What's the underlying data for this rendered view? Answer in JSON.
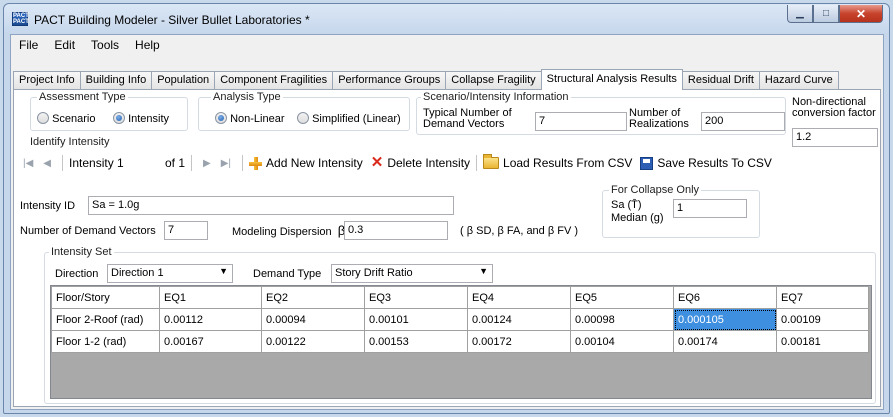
{
  "window": {
    "title": "PACT Building Modeler - Silver Bullet Laboratories *",
    "app_icon_text": [
      "PACT",
      "PACT"
    ]
  },
  "window_controls": {
    "minimize": "▁",
    "maximize": "□",
    "close": "✕"
  },
  "menu": [
    "File",
    "Edit",
    "Tools",
    "Help"
  ],
  "tabs": [
    "Project Info",
    "Building Info",
    "Population",
    "Component Fragilities",
    "Performance Groups",
    "Collapse Fragility",
    "Structural Analysis Results",
    "Residual Drift",
    "Hazard Curve"
  ],
  "active_tab": "Structural Analysis Results",
  "assessment_type": {
    "title": "Assessment Type",
    "options": [
      "Scenario",
      "Intensity"
    ],
    "selected": "Intensity"
  },
  "analysis_type": {
    "title": "Analysis Type",
    "options": [
      "Non-Linear",
      "Simplified (Linear)"
    ],
    "selected": "Non-Linear"
  },
  "scenario_info": {
    "title": "Scenario/Intensity Information",
    "demand_vectors_label": "Typical Number of\nDemand Vectors",
    "demand_vectors_value": "7",
    "realizations_label": "Number of\nRealizations",
    "realizations_value": "200"
  },
  "non_directional": {
    "label": "Non-directional\nconversion factor",
    "value": "1.2"
  },
  "identify_intensity": {
    "title": "Identify Intensity",
    "nav": {
      "first": "|◀",
      "prev": "◀",
      "next": "▶",
      "last": "▶|"
    },
    "current": "Intensity 1",
    "of": "of 1",
    "add": "Add New Intensity",
    "delete": "Delete Intensity",
    "load": "Load Results From CSV",
    "save": "Save Results To CSV"
  },
  "intensity_id": {
    "label": "Intensity ID",
    "value": "Sa = 1.0g"
  },
  "num_demand_vectors": {
    "label": "Number of Demand Vectors",
    "value": "7"
  },
  "modeling_dispersion": {
    "label": "Modeling Dispersion",
    "beta": "β",
    "sub": "m",
    "value": "0.3",
    "note": "( β SD, β FA, and β FV )"
  },
  "collapse_only": {
    "title": "For Collapse Only",
    "sa_label": "Sa (T̄)",
    "median_label": "Median (g)",
    "value": "1"
  },
  "intensity_set": {
    "title": "Intensity Set",
    "direction_label": "Direction",
    "direction_value": "Direction 1",
    "demand_type_label": "Demand Type",
    "demand_type_value": "Story Drift Ratio"
  },
  "table": {
    "columns": [
      "Floor/Story",
      "EQ1",
      "EQ2",
      "EQ3",
      "EQ4",
      "EQ5",
      "EQ6",
      "EQ7"
    ],
    "rows": [
      [
        "Floor 2-Roof (rad)",
        "0.00112",
        "0.00094",
        "0.00101",
        "0.00124",
        "0.00098",
        "0.000105",
        "0.00109"
      ],
      [
        "Floor 1-2 (rad)",
        "0.00167",
        "0.00122",
        "0.00153",
        "0.00172",
        "0.00104",
        "0.00174",
        "0.00181"
      ]
    ]
  },
  "colors": {
    "accent": "#3f8fe0",
    "close": "#c7432c",
    "frame": "#c6d7ec"
  }
}
